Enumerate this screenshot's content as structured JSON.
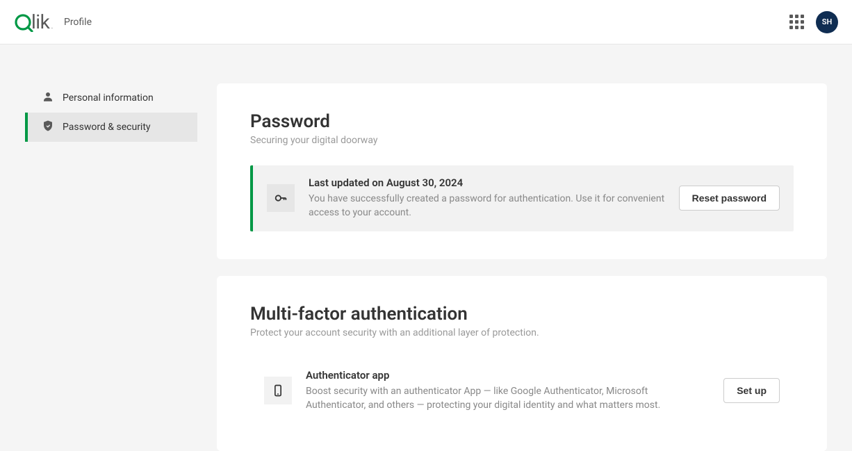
{
  "header": {
    "page_label": "Profile",
    "avatar_initials": "SH"
  },
  "sidebar": {
    "items": [
      {
        "label": "Personal information"
      },
      {
        "label": "Password & security"
      }
    ]
  },
  "password": {
    "title": "Password",
    "subtitle": "Securing your digital doorway",
    "info_title": "Last updated on August 30, 2024",
    "info_desc": "You have successfully created a password for authentication. Use it for convenient access to your account.",
    "reset_label": "Reset password"
  },
  "mfa": {
    "title": "Multi-factor authentication",
    "subtitle": "Protect your account security with an additional layer of protection.",
    "app_title": "Authenticator app",
    "app_desc": "Boost security with an authenticator App — like Google Authenticator, Microsoft Authenticator, and others — protecting your digital identity and what matters most.",
    "setup_label": "Set up"
  }
}
